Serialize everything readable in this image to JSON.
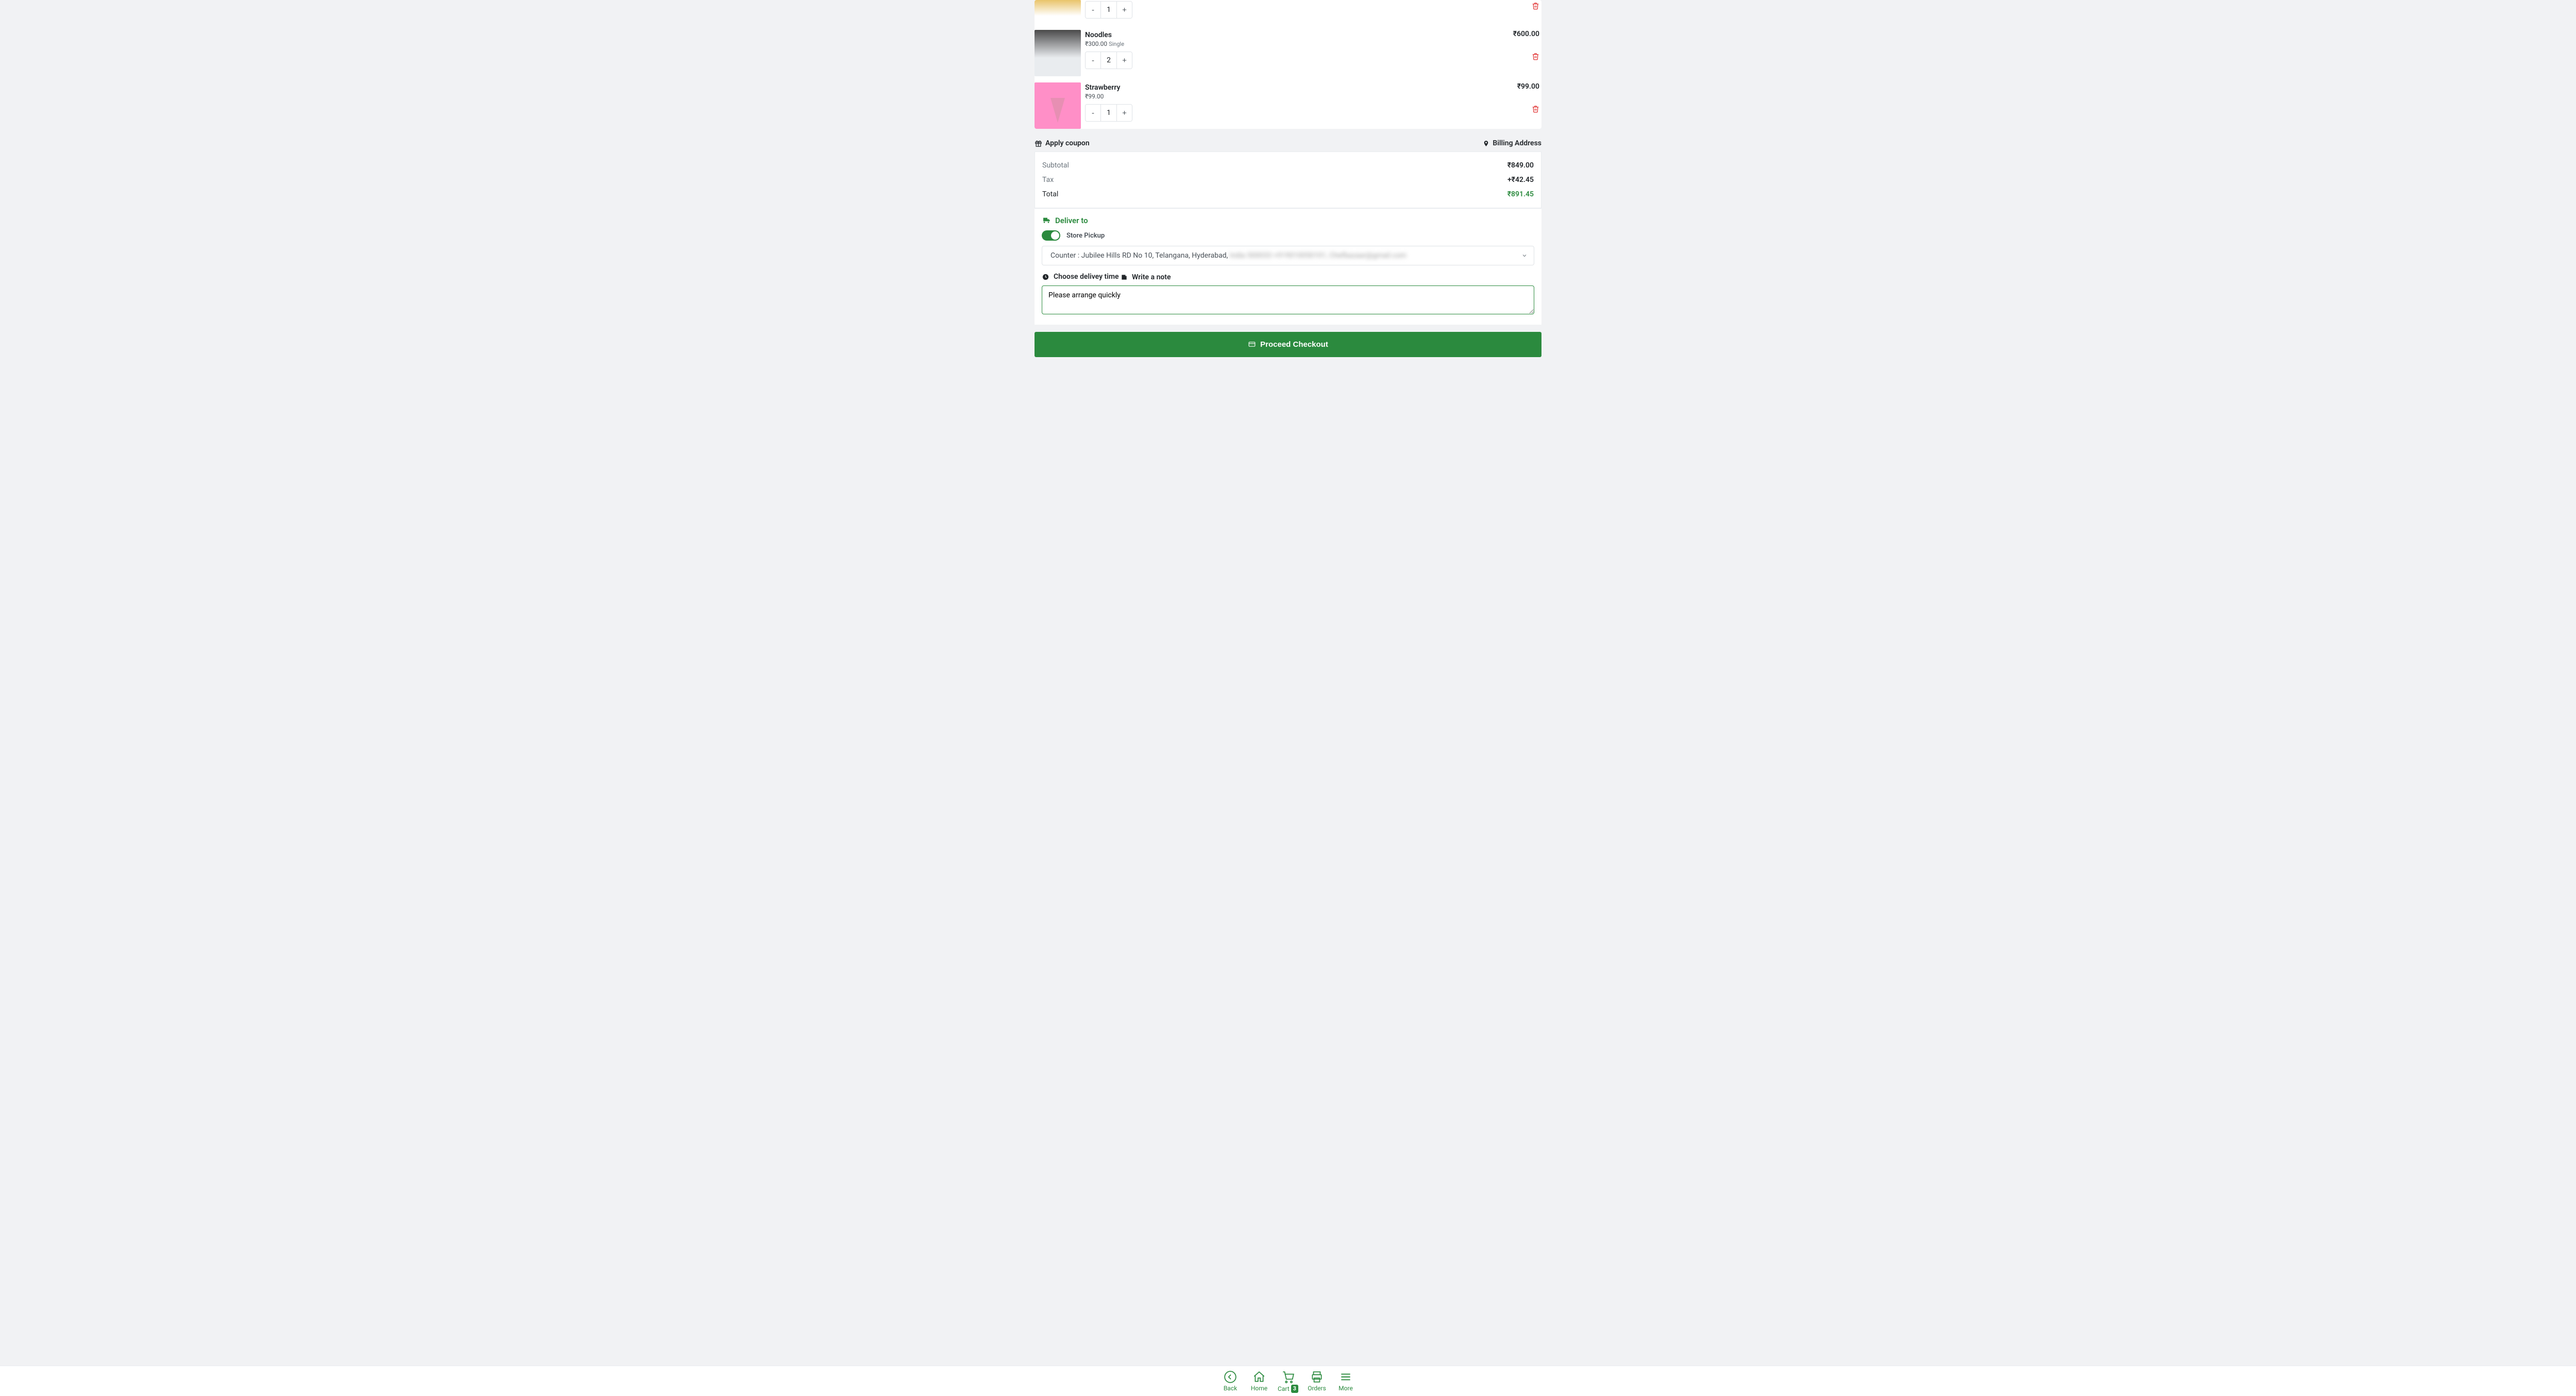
{
  "cart": {
    "items": [
      {
        "name": "",
        "price": "",
        "unit": "",
        "qty": "1",
        "line_total": ""
      },
      {
        "name": "Noodles",
        "price": "₹300.00",
        "unit": "Single",
        "qty": "2",
        "line_total": "₹600.00"
      },
      {
        "name": "Strawberry",
        "price": "₹99.00",
        "unit": "",
        "qty": "1",
        "line_total": "₹99.00"
      }
    ]
  },
  "links": {
    "apply_coupon": "Apply coupon",
    "billing_address": "Billing Address"
  },
  "summary": {
    "subtotal_label": "Subtotal",
    "subtotal_value": "₹849.00",
    "tax_label": "Tax",
    "tax_value": "+₹42.45",
    "total_label": "Total",
    "total_value": "₹891.45"
  },
  "delivery": {
    "deliver_to": "Deliver to",
    "store_pickup_label": "Store Pickup",
    "counter_prefix": "Counter : ",
    "counter_address_visible": "Jubilee Hills RD No 10, Telangana, Hyderabad, ",
    "counter_address_blurred": "India 500033 +919010050101, Chefbazaar@gmail.com",
    "choose_time": "Choose delivey time",
    "write_note_label": "Write a note",
    "note_value": "Please arrange quickly"
  },
  "checkout_label": "Proceed Checkout",
  "nav": {
    "back": "Back",
    "home": "Home",
    "cart": "Cart",
    "cart_badge": "3",
    "orders": "Orders",
    "more": "More"
  }
}
